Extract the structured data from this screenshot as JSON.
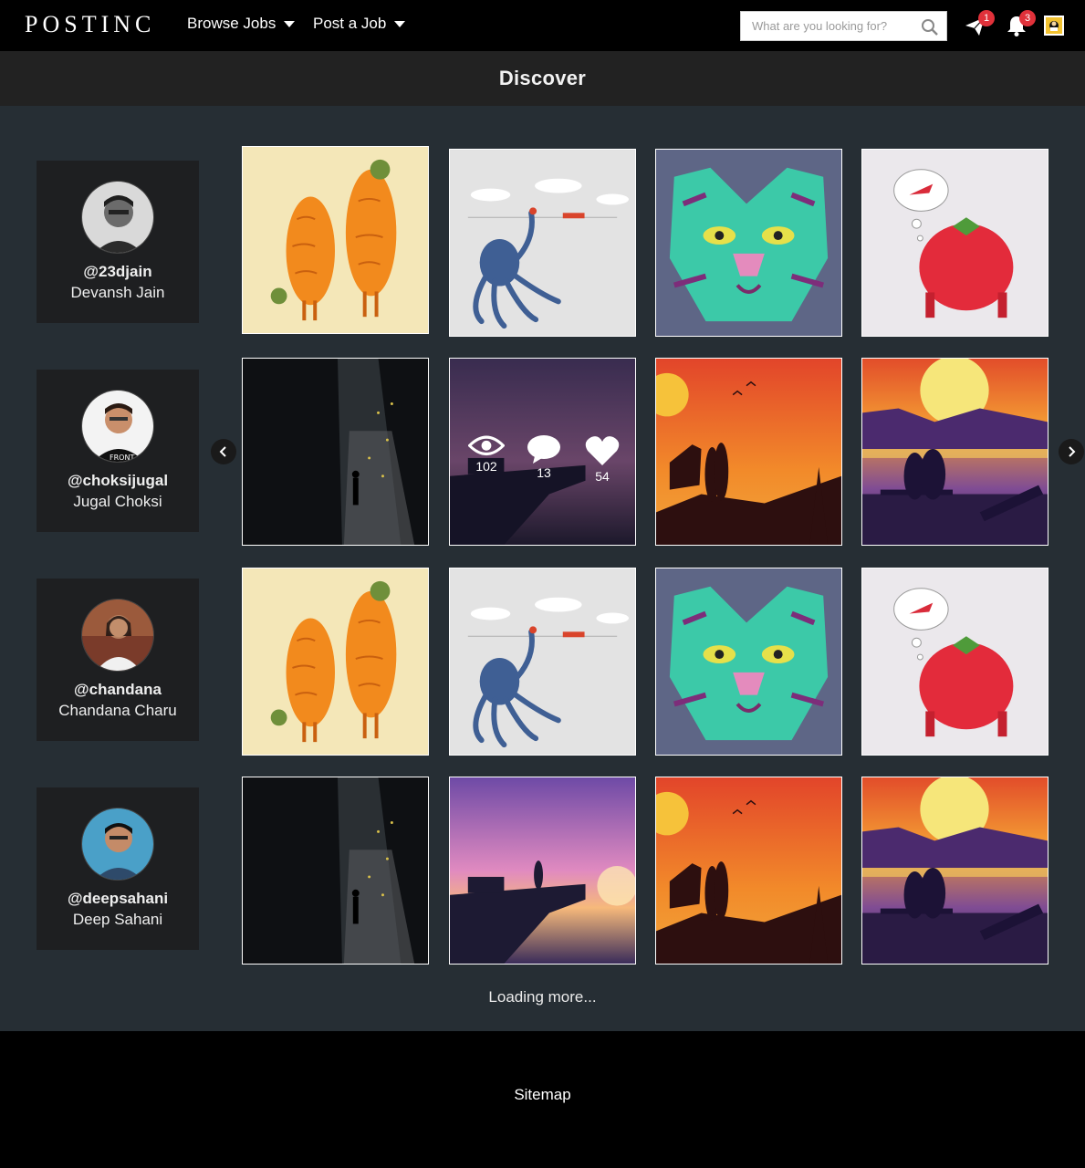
{
  "nav": {
    "logo": "POSTINC",
    "browse_jobs": "Browse Jobs",
    "post_job": "Post a Job",
    "search_placeholder": "What are you looking for?",
    "messages_count": "1",
    "notifications_count": "3"
  },
  "header": {
    "title": "Discover"
  },
  "users": [
    {
      "handle": "@23djain",
      "name": "Devansh Jain"
    },
    {
      "handle": "@choksijugal",
      "name": "Jugal Choksi"
    },
    {
      "handle": "@chandana",
      "name": "Chandana Charu"
    },
    {
      "handle": "@deepsahani",
      "name": "Deep Sahani"
    }
  ],
  "hover_stats": {
    "views": "102",
    "comments": "13",
    "likes": "54"
  },
  "loading_text": "Loading more...",
  "footer": {
    "sitemap": "Sitemap"
  },
  "colors": {
    "nav_bg": "#000000",
    "page_bg": "#262e34",
    "badge": "#e0313a"
  }
}
